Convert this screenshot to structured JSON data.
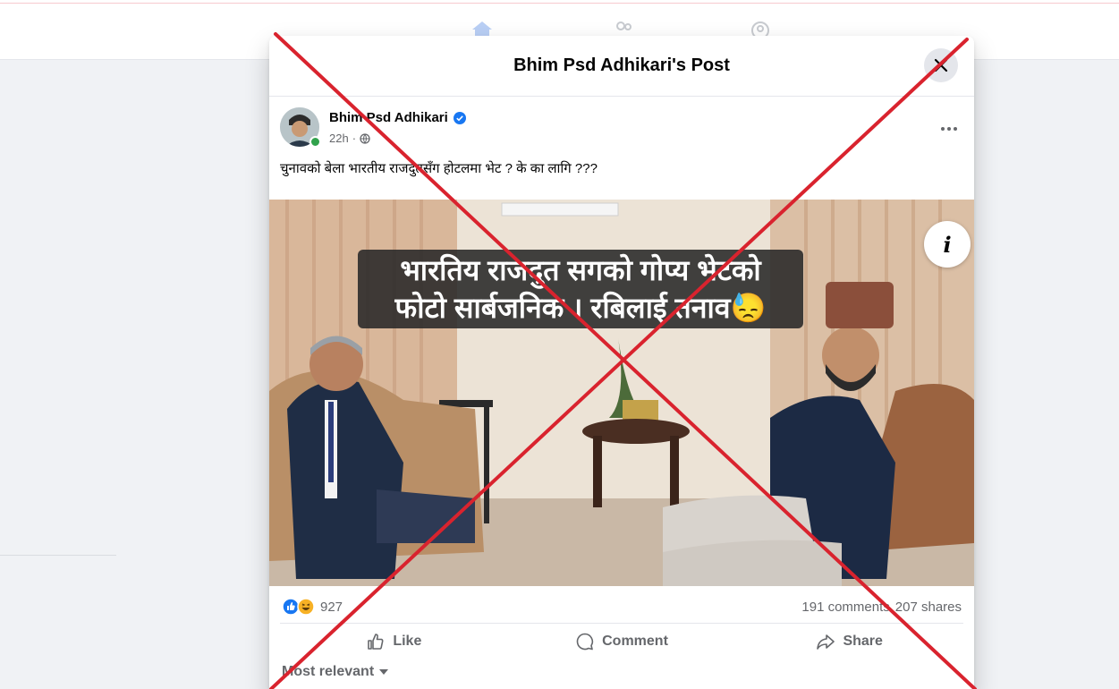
{
  "modal": {
    "title": "Bhim Psd Adhikari's Post",
    "close_icon": "close-icon"
  },
  "post": {
    "author": "Bhim Psd Adhikari",
    "verified_icon": "verified-badge-icon",
    "time": "22h",
    "audience_icon": "globe-icon",
    "text": "चुनावको बेला भारतीय राजदुतसँग होटलमा भेट ? के का लागि ???",
    "image_caption_line1": "भारतिय राजदुत सगको गोप्य भेटको",
    "image_caption_line2": "फोटो सार्बजनिक । रबिलाई तनाव😓",
    "image_info_label": "i"
  },
  "stats": {
    "reaction_icons": [
      "like-reaction-icon",
      "haha-reaction-icon"
    ],
    "reaction_count": "927",
    "comments": "191 comments",
    "shares": "207 shares"
  },
  "actions": {
    "like": "Like",
    "comment": "Comment",
    "share": "Share"
  },
  "comments_sort": "Most relevant",
  "colors": {
    "like_blue": "#1877f2",
    "cross_red": "#d9232e",
    "online_green": "#31a24c"
  }
}
